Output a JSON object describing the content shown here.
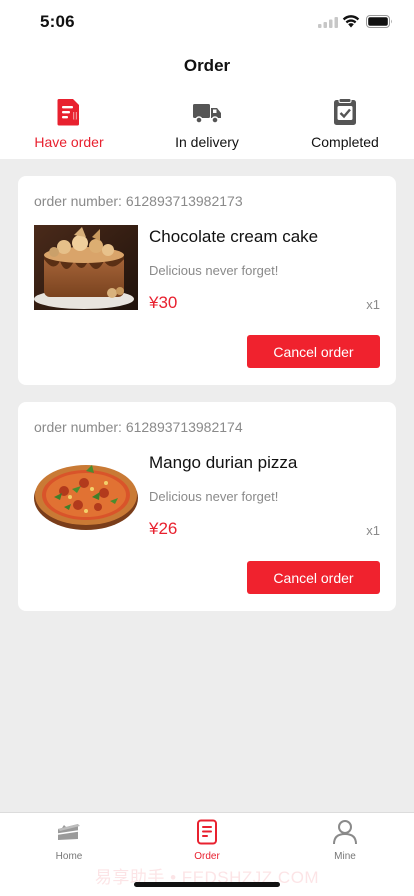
{
  "status_bar": {
    "time": "5:06"
  },
  "page_title": "Order",
  "tabs": [
    {
      "label": "Have order",
      "icon": "receipt-download-icon",
      "active": true
    },
    {
      "label": "In delivery",
      "icon": "delivery-truck-icon",
      "active": false
    },
    {
      "label": "Completed",
      "icon": "check-clipboard-icon",
      "active": false
    }
  ],
  "orders": [
    {
      "order_number": "order number: 612893713982173",
      "name": "Chocolate cream cake",
      "description": "Delicious never forget!",
      "price": "¥30",
      "quantity": "x1",
      "action": "Cancel order",
      "image": "chocolate-cake-image"
    },
    {
      "order_number": "order number: 612893713982174",
      "name": "Mango durian pizza",
      "description": "Delicious never forget!",
      "price": "¥26",
      "quantity": "x1",
      "action": "Cancel order",
      "image": "pizza-image"
    }
  ],
  "bottom_nav": [
    {
      "label": "Home",
      "icon": "cake-slice-icon",
      "active": false
    },
    {
      "label": "Order",
      "icon": "order-document-icon",
      "active": true
    },
    {
      "label": "Mine",
      "icon": "person-icon",
      "active": false
    }
  ],
  "watermark": "易享助手 • FEDSHZJZ.COM",
  "colors": {
    "accent": "#e8212f",
    "button": "#f0222e",
    "background": "#ededed"
  }
}
